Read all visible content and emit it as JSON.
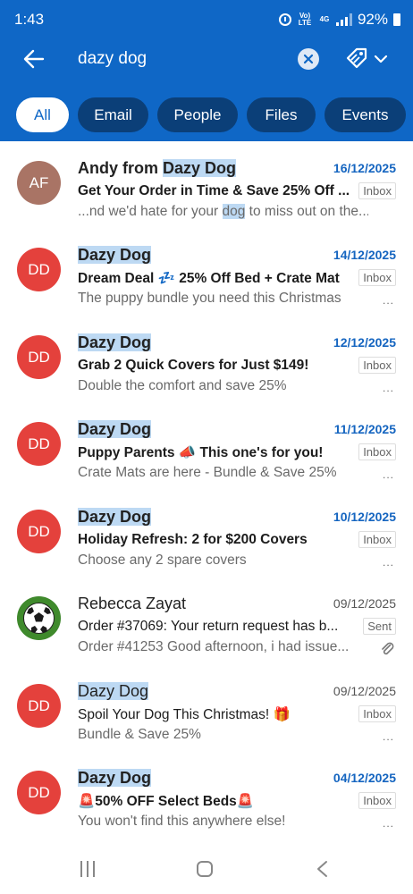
{
  "status": {
    "time": "1:43",
    "volte": "Vo) LTE",
    "network": "4G",
    "battery": "92%"
  },
  "search": {
    "query": "dazy dog"
  },
  "chips": [
    {
      "label": "All",
      "active": true
    },
    {
      "label": "Email",
      "active": false
    },
    {
      "label": "People",
      "active": false
    },
    {
      "label": "Files",
      "active": false
    },
    {
      "label": "Events",
      "active": false
    }
  ],
  "emails": [
    {
      "avatar": "AF",
      "avatar_color": "#a97465",
      "sender_pre": "Andy from ",
      "sender_hl": "Dazy Dog",
      "sender_post": "",
      "date": "16/12/2025",
      "unread": true,
      "subject": "Get Your Order in Time & Save 25% Off ...",
      "folder": "Inbox",
      "preview_pre": "...nd we'd hate for your ",
      "preview_hl": "dog",
      "preview_post": " to miss out on the...",
      "trailing": "none"
    },
    {
      "avatar": "DD",
      "avatar_color": "#e4413c",
      "sender_pre": "",
      "sender_hl": "Dazy Dog",
      "sender_post": "",
      "date": "14/12/2025",
      "unread": true,
      "subject": "Dream Deal 💤 25% Off Bed + Crate Mat",
      "folder": "Inbox",
      "preview_pre": "The puppy bundle you need this Christmas",
      "preview_hl": "",
      "preview_post": "",
      "trailing": "dots"
    },
    {
      "avatar": "DD",
      "avatar_color": "#e4413c",
      "sender_pre": "",
      "sender_hl": "Dazy Dog",
      "sender_post": "",
      "date": "12/12/2025",
      "unread": true,
      "subject": "Grab 2 Quick Covers for Just $149!",
      "folder": "Inbox",
      "preview_pre": "Double the comfort and save 25%",
      "preview_hl": "",
      "preview_post": "",
      "trailing": "dots"
    },
    {
      "avatar": "DD",
      "avatar_color": "#e4413c",
      "sender_pre": "",
      "sender_hl": "Dazy Dog",
      "sender_post": "",
      "date": "11/12/2025",
      "unread": true,
      "subject": "Puppy Parents 📣 This one's for you!",
      "folder": "Inbox",
      "preview_pre": "Crate Mats are here - Bundle & Save 25%",
      "preview_hl": "",
      "preview_post": "",
      "trailing": "dots"
    },
    {
      "avatar": "DD",
      "avatar_color": "#e4413c",
      "sender_pre": "",
      "sender_hl": "Dazy Dog",
      "sender_post": "",
      "date": "10/12/2025",
      "unread": true,
      "subject": "Holiday Refresh: 2 for $200 Covers",
      "folder": "Inbox",
      "preview_pre": "Choose any 2 spare covers",
      "preview_hl": "",
      "preview_post": "",
      "trailing": "dots"
    },
    {
      "avatar": "",
      "avatar_color": "#2e6d1f",
      "sender_pre": "Rebecca Zayat",
      "sender_hl": "",
      "sender_post": "",
      "date": "09/12/2025",
      "unread": false,
      "subject": "Order #37069: Your return request has b...",
      "folder": "Sent",
      "preview_pre": "Order #41253 Good afternoon, i had issue...",
      "preview_hl": "",
      "preview_post": "",
      "trailing": "attachment"
    },
    {
      "avatar": "DD",
      "avatar_color": "#e4413c",
      "sender_pre": "",
      "sender_hl": "Dazy Dog",
      "sender_post": "",
      "date": "09/12/2025",
      "unread": false,
      "subject": "Spoil Your Dog This Christmas! 🎁",
      "folder": "Inbox",
      "preview_pre": "Bundle & Save 25%",
      "preview_hl": "",
      "preview_post": "",
      "trailing": "dots"
    },
    {
      "avatar": "DD",
      "avatar_color": "#e4413c",
      "sender_pre": "",
      "sender_hl": "Dazy Dog",
      "sender_post": "",
      "date": "04/12/2025",
      "unread": true,
      "subject": "🚨50% OFF Select Beds🚨",
      "folder": "Inbox",
      "preview_pre": "You won't find this anywhere else!",
      "preview_hl": "",
      "preview_post": "",
      "trailing": "dots"
    }
  ],
  "colors": {
    "header_blue": "#0f67c6",
    "chip_dark": "#0b3f78",
    "unread_date": "#1565c0",
    "highlight": "#bdd9f3"
  }
}
